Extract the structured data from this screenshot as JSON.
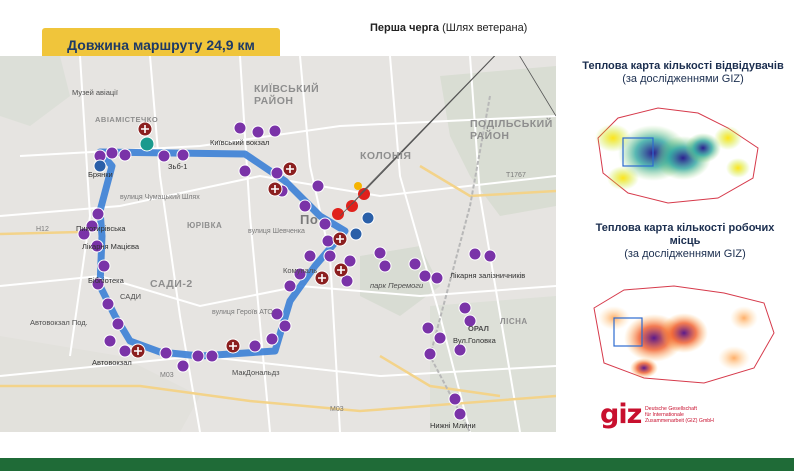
{
  "route_length": "Довжина маршруту 24,9 км",
  "first_stage": {
    "bold": "Перша черга",
    "rest": " (Шлях ветерана)"
  },
  "districts": {
    "kyivskyi": "КИЇВСЬКИЙ\nРАЙОН",
    "podilskyi": "ПОДІЛЬСЬКИЙ\nРАЙОН",
    "koloniia": "КОЛОНІЯ",
    "sadi2": "САДИ-2",
    "aviamistechko": "АВІАМІСТЕЧКО",
    "yurivka": "ЮРІВКА",
    "lisna": "ЛІСНА"
  },
  "poi_labels": {
    "brianky": "Брянки",
    "zby1": "Зьб-1",
    "kyivskyi_vokzal": "Київський вокзал",
    "pikotyrivska": "Пикотирівська",
    "likarnia_matsyieva": "Лікарня Мацієва",
    "biblioteka": "Біблiотека",
    "avtovokzal": "Автовокзал",
    "likarnia_zaliznychnykiv": "Лікарня залізничників",
    "park_peremohy": "парк Перемоги",
    "vul_holovka": "Вул.Головка",
    "nyzhni_mlyny": "Нижні Млини",
    "makdonalds": "МакДональдз",
    "sadi": "САДИ",
    "oral": "ОРАЛ",
    "chumatskyi_shliakh": "вулиця Чумацький Шлях",
    "heroiv_ato": "вулиця Героїв АТО",
    "shevchenka": "вулиця Шевченка",
    "poltava": "По",
    "kommunalnyi": "Комуналь",
    "muzei": "Музей авіації",
    "avtovokzal_pod": "Автовокзал Под."
  },
  "roads": {
    "m03": "M03",
    "h12": "H12",
    "t1767": "T1767",
    "m03b": "M03"
  },
  "heatmap_visitors": {
    "title_bold": "Теплова карта кількості відвідувачів",
    "title_rest": " (за дослідженнями GIZ)"
  },
  "heatmap_jobs": {
    "title_bold": "Теплова карта кількості робочих місць",
    "title_rest": "(за дослідженнями GIZ)"
  },
  "giz_logo": {
    "mark": "giz",
    "org_line1": "Deutsche Gesellschaft",
    "org_line2": "für Internationale",
    "org_line3": "Zusammenarbeit (GIZ) GmbH"
  },
  "colors": {
    "banner": "#f0c53b",
    "route": "#3b7fd6",
    "marker_purple": "#7a33a8",
    "marker_red": "#8b1f1f",
    "footer": "#1f6b37"
  },
  "icons": [
    "bus-stop-icon",
    "hospital-icon",
    "library-icon",
    "location-pin-icon"
  ]
}
